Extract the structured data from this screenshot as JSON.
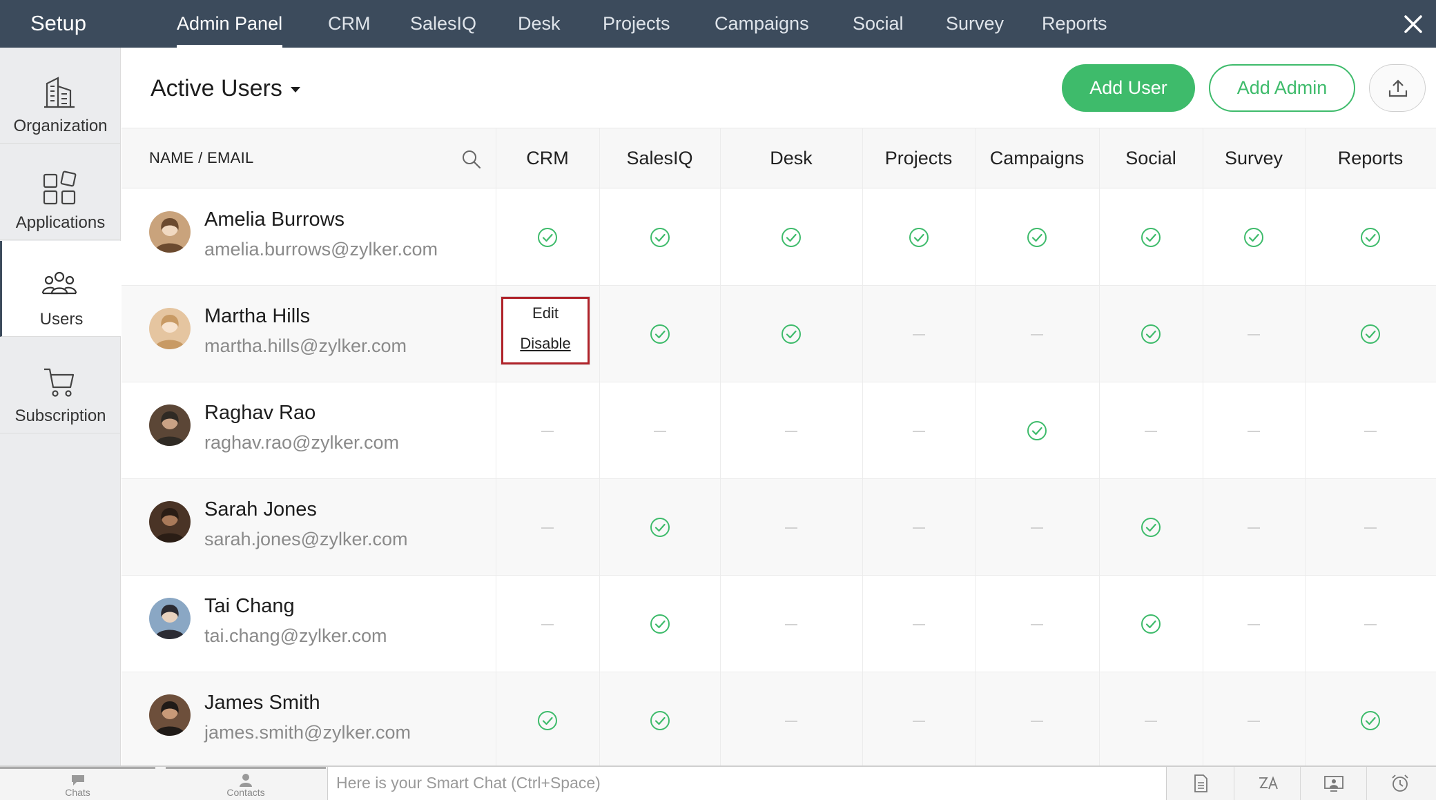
{
  "topbar": {
    "title": "Setup",
    "nav": [
      {
        "label": "Admin Panel",
        "active": true
      },
      {
        "label": "CRM"
      },
      {
        "label": "SalesIQ"
      },
      {
        "label": "Desk"
      },
      {
        "label": "Projects"
      },
      {
        "label": "Campaigns"
      },
      {
        "label": "Social"
      },
      {
        "label": "Survey"
      },
      {
        "label": "Reports"
      }
    ],
    "close_icon": "close-icon"
  },
  "sidebar": {
    "items": [
      {
        "label": "Organization",
        "icon": "building-icon"
      },
      {
        "label": "Applications",
        "icon": "apps-grid-icon"
      },
      {
        "label": "Users",
        "icon": "users-icon",
        "active": true
      },
      {
        "label": "Subscription",
        "icon": "cart-icon"
      }
    ]
  },
  "main": {
    "title": "Active Users",
    "add_user_label": "Add User",
    "add_admin_label": "Add Admin",
    "upload_icon": "upload-icon"
  },
  "table": {
    "name_header": "NAME / EMAIL",
    "columns": [
      "CRM",
      "SalesIQ",
      "Desk",
      "Projects",
      "Campaigns",
      "Social",
      "Survey",
      "Reports"
    ],
    "rows": [
      {
        "name": "Amelia Burrows",
        "email": "amelia.burrows@zylker.com",
        "access": [
          true,
          true,
          true,
          true,
          true,
          true,
          true,
          true
        ]
      },
      {
        "name": "Martha Hills",
        "email": "martha.hills@zylker.com",
        "access": [
          null,
          true,
          true,
          false,
          false,
          true,
          false,
          true
        ]
      },
      {
        "name": "Raghav Rao",
        "email": "raghav.rao@zylker.com",
        "access": [
          false,
          false,
          false,
          false,
          true,
          false,
          false,
          false
        ]
      },
      {
        "name": "Sarah Jones",
        "email": "sarah.jones@zylker.com",
        "access": [
          false,
          true,
          false,
          false,
          false,
          true,
          false,
          false
        ]
      },
      {
        "name": "Tai Chang",
        "email": "tai.chang@zylker.com",
        "access": [
          false,
          true,
          false,
          false,
          false,
          true,
          false,
          false
        ]
      },
      {
        "name": "James Smith",
        "email": "james.smith@zylker.com",
        "access": [
          true,
          true,
          false,
          false,
          false,
          false,
          false,
          true
        ]
      }
    ],
    "context_menu": {
      "edit": "Edit",
      "disable": "Disable"
    }
  },
  "colors": {
    "topbar": "#3c4b5c",
    "accent": "#3ebb6b",
    "popup_border": "#b0232a"
  },
  "bottombar": {
    "chats_label": "Chats",
    "contacts_label": "Contacts",
    "chat_placeholder": "Here is your Smart Chat (Ctrl+Space)"
  }
}
